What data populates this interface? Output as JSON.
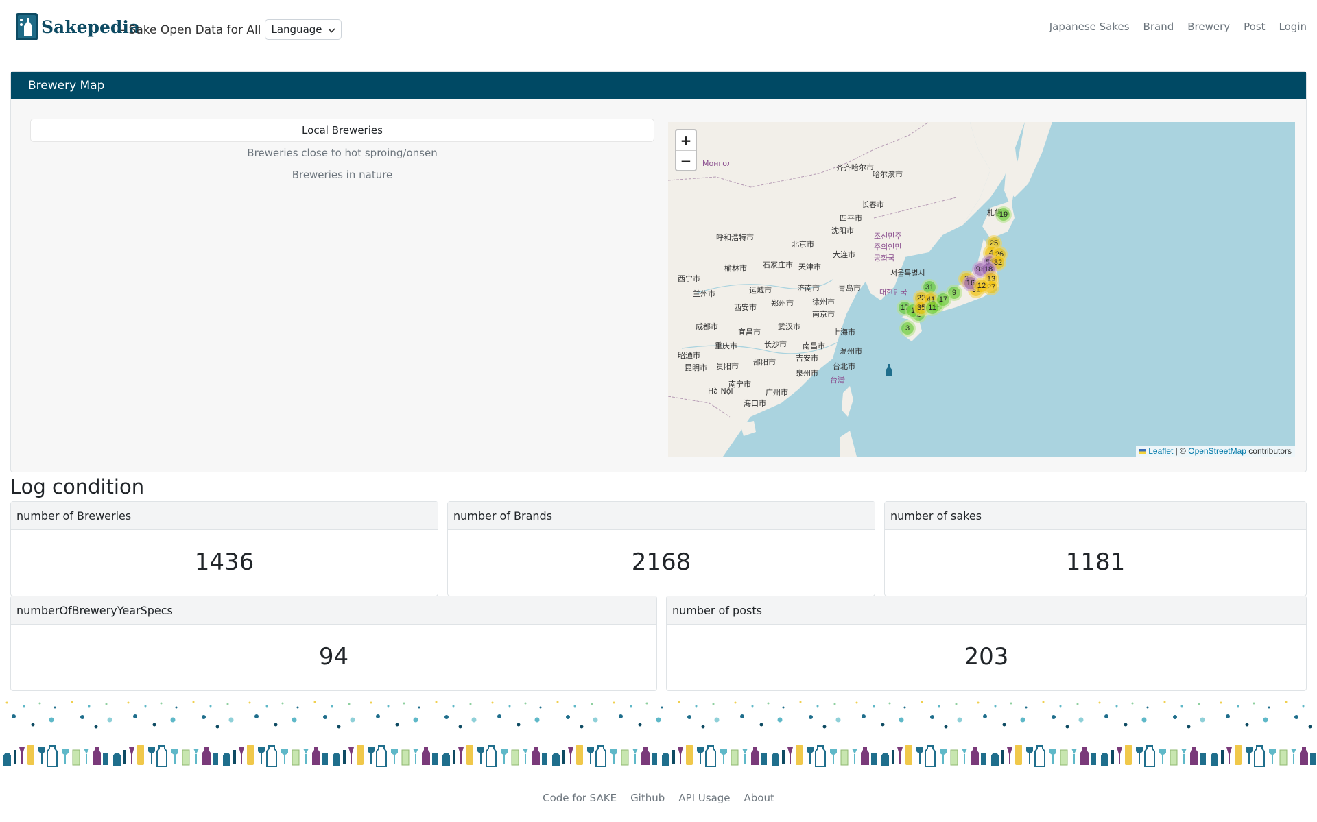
{
  "header": {
    "logo_text": "Sakepedia",
    "tagline": "- Sake Open Data for All",
    "language_label": "Language",
    "nav": [
      "Japanese Sakes",
      "Brand",
      "Brewery",
      "Post",
      "Login"
    ]
  },
  "brewery_map": {
    "title": "Brewery Map",
    "filters": [
      "Local Breweries",
      "Breweries close to hot sproing/onsen",
      "Breweries in nature"
    ],
    "active_filter": "Local Breweries",
    "zoom_in": "+",
    "zoom_out": "−",
    "attribution": {
      "leaflet": "Leaflet",
      "separator": " | © ",
      "osm": "OpenStreetMap",
      "suffix": " contributors"
    },
    "clusters": [
      "19",
      "25",
      "4",
      "26",
      "53",
      "32",
      "98",
      "18",
      "3",
      "13",
      "27",
      "31",
      "16",
      "12",
      "9",
      "31",
      "22",
      "17",
      "15",
      "2",
      "3",
      "1",
      "35",
      "41",
      "17",
      "11"
    ],
    "cities": [
      "齐齐哈尔市",
      "哈尔滨市",
      "长春市",
      "四平市",
      "沈阳市",
      "呼和浩特市",
      "北京市",
      "大连市",
      "石家庄市",
      "天津市",
      "榆林市",
      "西宁市",
      "兰州市",
      "运城市",
      "济南市",
      "青岛市",
      "西安市",
      "郑州市",
      "徐州市",
      "南京市",
      "成都市",
      "宜昌市",
      "武汉市",
      "上海市",
      "重庆市",
      "长沙市",
      "南昌市",
      "温州市",
      "昭通市",
      "昆明市",
      "贵阳市",
      "邵阳市",
      "吉安市",
      "泉州市",
      "台北市",
      "南宁市",
      "广州市",
      "海口市",
      "Hà Nội",
      "서울특별시",
      "札幌市",
      "조선민주주의인민공화국",
      "대한민국",
      "台灣",
      "Монгол"
    ]
  },
  "log": {
    "title": "Log condition",
    "cards": [
      {
        "label": "number of Breweries",
        "value": "1436"
      },
      {
        "label": "number of Brands",
        "value": "2168"
      },
      {
        "label": "number of sakes",
        "value": "1181"
      },
      {
        "label": "numberOfBreweryYearSpecs",
        "value": "94"
      },
      {
        "label": "number of posts",
        "value": "203"
      }
    ]
  },
  "footer": {
    "links": [
      "Code for SAKE",
      "Github",
      "API Usage",
      "About"
    ]
  }
}
